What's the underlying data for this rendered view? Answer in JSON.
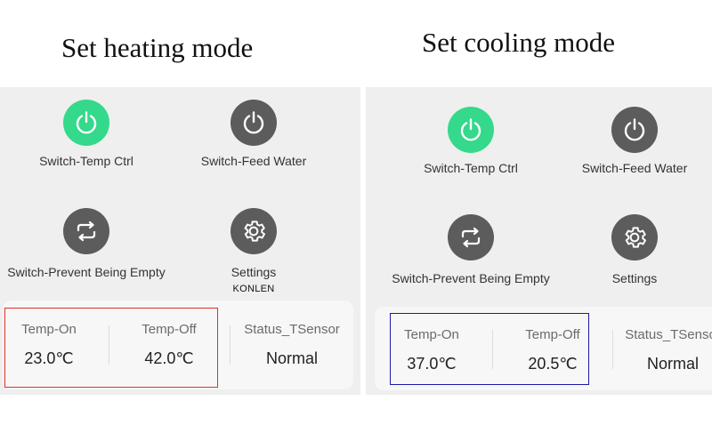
{
  "left": {
    "heading": "Set heating mode",
    "switch_temp_ctrl": "Switch-Temp Ctrl",
    "switch_feed_water": "Switch-Feed Water",
    "switch_prevent_empty": "Switch-Prevent Being Empty",
    "settings": "Settings",
    "watermark": "KONLEN",
    "temp_on_label": "Temp-On",
    "temp_on_value": "23.0℃",
    "temp_off_label": "Temp-Off",
    "temp_off_value": "42.0℃",
    "status_label": "Status_TSensor",
    "status_value": "Normal",
    "highlight_color": "#e0302a"
  },
  "right": {
    "heading": "Set cooling mode",
    "switch_temp_ctrl": "Switch-Temp Ctrl",
    "switch_feed_water": "Switch-Feed Water",
    "switch_prevent_empty": "Switch-Prevent Being Empty",
    "settings": "Settings",
    "temp_on_label": "Temp-On",
    "temp_on_value": "37.0℃",
    "temp_off_label": "Temp-Off",
    "temp_off_value": "20.5℃",
    "status_label": "Status_TSensor",
    "status_value": "Normal",
    "highlight_color": "#1a1aa6"
  },
  "colors": {
    "power_on": "#34d98b",
    "icon_off": "#5c5c5c",
    "panel_bg": "#efefef"
  },
  "icons": [
    "power-icon",
    "repeat-icon",
    "gear-icon"
  ]
}
